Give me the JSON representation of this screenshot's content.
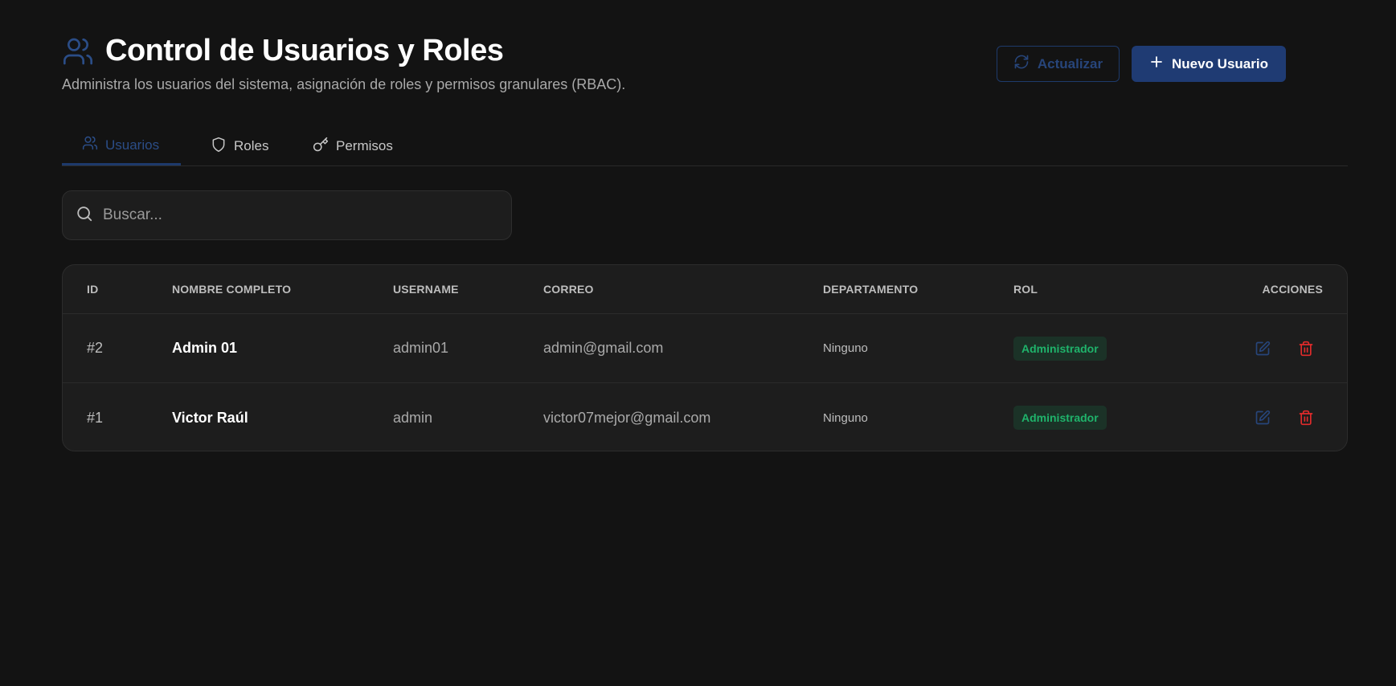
{
  "header": {
    "title": "Control de Usuarios y Roles",
    "subtitle": "Administra los usuarios del sistema, asignación de roles y permisos granulares (RBAC).",
    "refresh_label": "Actualizar",
    "new_user_label": "Nuevo Usuario"
  },
  "tabs": [
    {
      "label": "Usuarios",
      "icon": "users-icon",
      "active": true
    },
    {
      "label": "Roles",
      "icon": "shield-icon",
      "active": false
    },
    {
      "label": "Permisos",
      "icon": "key-icon",
      "active": false
    }
  ],
  "search": {
    "placeholder": "Buscar...",
    "value": ""
  },
  "table": {
    "columns": [
      "ID",
      "NOMBRE COMPLETO",
      "USERNAME",
      "CORREO",
      "DEPARTAMENTO",
      "ROL",
      "ACCIONES"
    ],
    "rows": [
      {
        "id": "#2",
        "name": "Admin 01",
        "username": "admin01",
        "email": "admin@gmail.com",
        "department": "Ninguno",
        "role": "Administrador"
      },
      {
        "id": "#1",
        "name": "Victor Raúl",
        "username": "admin",
        "email": "victor07mejor@gmail.com",
        "department": "Ninguno",
        "role": "Administrador"
      }
    ]
  },
  "colors": {
    "background": "#131313",
    "primary": "#1f3b73",
    "accent_blue": "#2b4d87",
    "role_badge_text": "#1fb36b",
    "role_badge_bg": "#1b3227",
    "delete_red": "#e02b2b"
  }
}
